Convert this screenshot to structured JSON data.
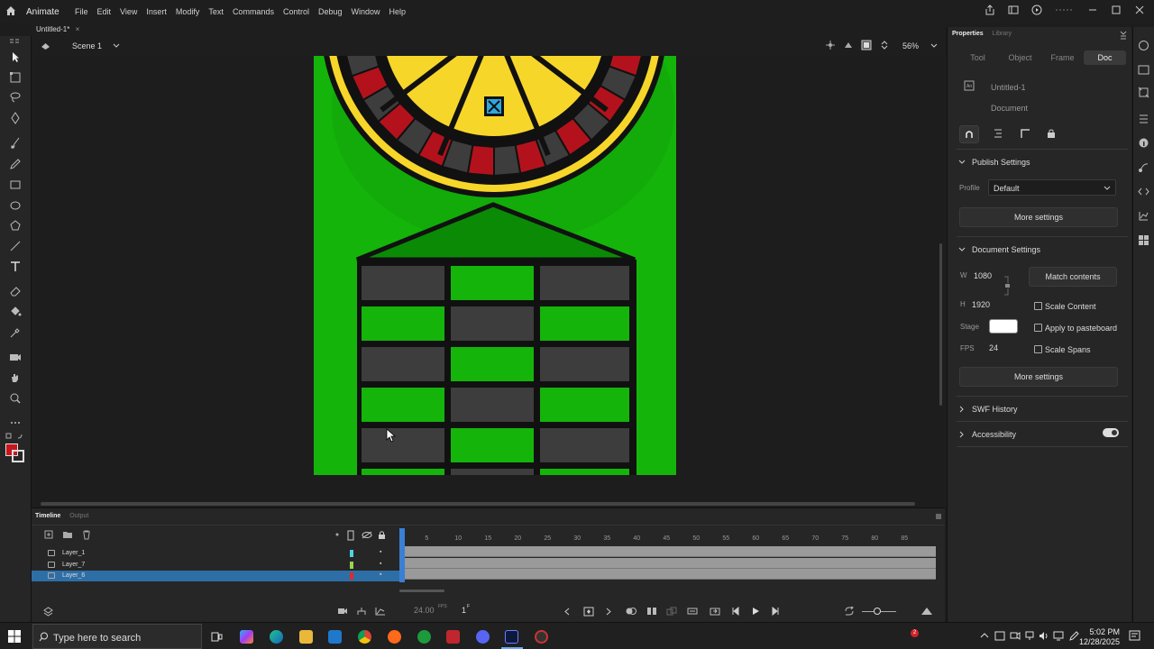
{
  "app": {
    "name": "Animate",
    "menus": [
      "File",
      "Edit",
      "View",
      "Insert",
      "Modify",
      "Text",
      "Commands",
      "Control",
      "Debug",
      "Window",
      "Help"
    ]
  },
  "document": {
    "tab_title": "Untitled-1*",
    "tab_close": "×",
    "scene_name": "Scene 1",
    "zoom": "56%"
  },
  "properties": {
    "top_tabs": [
      "Properties",
      "Library"
    ],
    "sub_tabs": [
      "Tool",
      "Object",
      "Frame",
      "Doc"
    ],
    "active_sub_tab": "Doc",
    "doc_name": "Untitled-1",
    "doc_type": "Document",
    "publish_settings": {
      "title": "Publish Settings",
      "profile_label": "Profile",
      "profile_value": "Default",
      "more_label": "More settings"
    },
    "document_settings": {
      "title": "Document Settings",
      "w_label": "W",
      "w_value": "1080",
      "h_label": "H",
      "h_value": "1920",
      "match_label": "Match contents",
      "stage_label": "Stage",
      "stage_color": "#ffffff",
      "fps_label": "FPS",
      "fps_value": "24",
      "checkboxes": [
        "Scale Content",
        "Apply to pasteboard",
        "Scale Spans"
      ],
      "more_label": "More settings"
    },
    "swf_history": "SWF History",
    "accessibility": "Accessibility"
  },
  "timeline": {
    "tabs": [
      "Timeline",
      "Output"
    ],
    "layers": [
      {
        "name": "Layer_1",
        "color": "#4fd2e6"
      },
      {
        "name": "Layer_7",
        "color": "#9bd24f"
      },
      {
        "name": "Layer_6",
        "color": "#e02a2a",
        "selected": true
      }
    ],
    "ruler_marks": [
      "1",
      "5",
      "10",
      "15",
      "20",
      "25",
      "30",
      "35",
      "40",
      "45",
      "50",
      "55",
      "60",
      "65",
      "70",
      "75",
      "80",
      "85"
    ],
    "fps_display": "24.00",
    "fps_unit": "FPS",
    "frame_display": "1",
    "frame_unit": "F"
  },
  "taskbar": {
    "search_placeholder": "Type here to search",
    "time": "5:02 PM",
    "date": "12/28/2025",
    "notification_count": "2"
  },
  "colors": {
    "stage_green": "#14b40a",
    "wheel_yellow": "#f7d62a",
    "wheel_red": "#b3121c",
    "cell_grey": "#3d3d3d",
    "accent_blue": "#2e6ea6"
  }
}
